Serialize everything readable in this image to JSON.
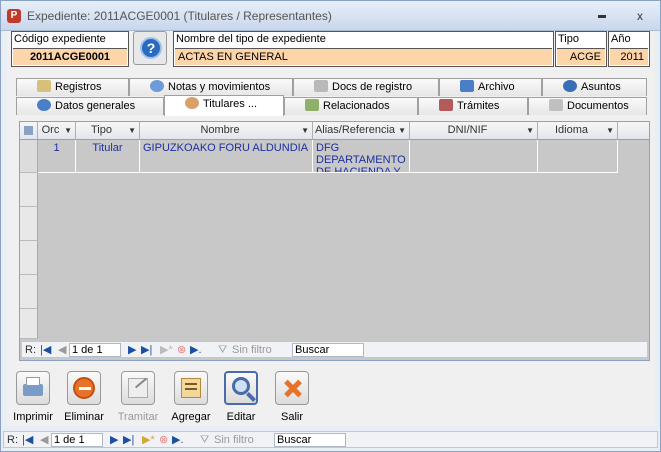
{
  "window": {
    "title": "Expediente: 2011ACGE0001 (Titulares / Representantes)",
    "min_icon": "minimize-icon",
    "close_glyph": "x"
  },
  "header": {
    "codigo_label": "Código expediente",
    "codigo_value": "2011ACGE0001",
    "help_glyph": "?",
    "nombre_label": "Nombre del tipo de expediente",
    "nombre_value": "ACTAS EN GENERAL",
    "tipo_label": "Tipo",
    "tipo_value": "ACGE",
    "anio_label": "Año",
    "anio_value": "2011"
  },
  "tabs_row1": [
    {
      "label": "Registros",
      "icon": "registros-icon"
    },
    {
      "label": "Notas y movimientos",
      "icon": "notas-icon"
    },
    {
      "label": "Docs de registro",
      "icon": "docs-registro-icon"
    },
    {
      "label": "Archivo",
      "icon": "archivo-icon"
    },
    {
      "label": "Asuntos",
      "icon": "asuntos-icon"
    }
  ],
  "tabs_row2": [
    {
      "label": "Datos generales",
      "icon": "datos-icon"
    },
    {
      "label": "Titulares ...",
      "icon": "titulares-icon",
      "active": true
    },
    {
      "label": "Relacionados",
      "icon": "relacionados-icon"
    },
    {
      "label": "Trámites",
      "icon": "tramites-icon"
    },
    {
      "label": "Documentos",
      "icon": "documentos-icon"
    }
  ],
  "grid": {
    "columns": [
      "Orc",
      "Tipo",
      "Nombre",
      "Alias/Referencia",
      "DNI/NIF",
      "Idioma"
    ],
    "rows": [
      {
        "orden": "1",
        "tipo": "Titular",
        "nombre": "GIPUZKOAKO FORU ALDUNDIA",
        "alias": "DFG DEPARTAMENTO DE HACIENDA Y",
        "dni": "",
        "idioma": ""
      }
    ]
  },
  "grid_nav": {
    "r_label": "R:",
    "page": "1 de 1",
    "filter": "Sin filtro",
    "search": "Buscar"
  },
  "toolbar": {
    "imprimir": "Imprimir",
    "eliminar": "Eliminar",
    "tramitar": "Tramitar",
    "agregar": "Agregar",
    "editar": "Editar",
    "salir": "Salir"
  },
  "form_nav": {
    "r_label": "R:",
    "page": "1 de 1",
    "filter": "Sin filtro",
    "search": "Buscar"
  },
  "colors": {
    "value_bg": "#fcd5a8",
    "grid_text": "#1c2f9e"
  }
}
